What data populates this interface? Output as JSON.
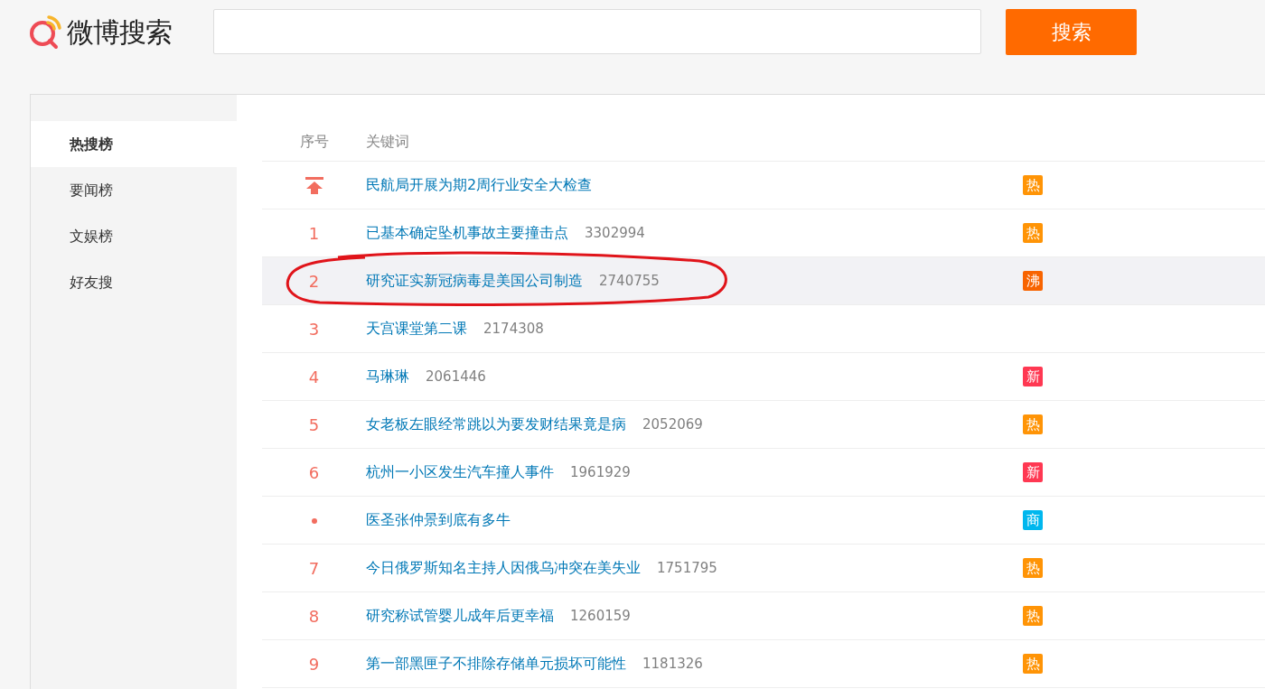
{
  "header": {
    "logo_text": "微博搜索",
    "search_button": "搜索"
  },
  "sidebar": {
    "items": [
      {
        "label": "热搜榜",
        "selected": true
      },
      {
        "label": "要闻榜",
        "selected": false
      },
      {
        "label": "文娱榜",
        "selected": false
      },
      {
        "label": "好友搜",
        "selected": false
      }
    ]
  },
  "table": {
    "columns": [
      "序号",
      "关键词"
    ],
    "rows": [
      {
        "kind": "pinned",
        "keyword": "民航局开展为期2周行业安全大检查",
        "badge": "热",
        "color": "#ff9406",
        "highlighted": false,
        "circled": false
      },
      {
        "kind": "number",
        "rank": "1",
        "keyword": "已基本确定坠机事故主要撞击点",
        "count": "3302994",
        "badge": "热",
        "color": "#ff9406",
        "highlighted": false,
        "circled": false
      },
      {
        "kind": "number",
        "rank": "2",
        "keyword": "研究证实新冠病毒是美国公司制造",
        "count": "2740755",
        "badge": "沸",
        "color": "#f86400",
        "highlighted": true,
        "circled": true
      },
      {
        "kind": "number",
        "rank": "3",
        "keyword": "天宫课堂第二课",
        "count": "2174308",
        "highlighted": false,
        "circled": false
      },
      {
        "kind": "number",
        "rank": "4",
        "keyword": "马琳琳",
        "count": "2061446",
        "badge": "新",
        "color": "#ff3852",
        "highlighted": false,
        "circled": false
      },
      {
        "kind": "number",
        "rank": "5",
        "keyword": "女老板左眼经常跳以为要发财结果竟是病",
        "count": "2052069",
        "badge": "热",
        "color": "#ff9406",
        "highlighted": false,
        "circled": false
      },
      {
        "kind": "number",
        "rank": "6",
        "keyword": "杭州一小区发生汽车撞人事件",
        "count": "1961929",
        "badge": "新",
        "color": "#ff3852",
        "highlighted": false,
        "circled": false
      },
      {
        "kind": "dot",
        "keyword": "医圣张仲景到底有多牛",
        "badge": "商",
        "color": "#00b7ee",
        "highlighted": false,
        "circled": false
      },
      {
        "kind": "number",
        "rank": "7",
        "keyword": "今日俄罗斯知名主持人因俄乌冲突在美失业",
        "count": "1751795",
        "badge": "热",
        "color": "#ff9406",
        "highlighted": false,
        "circled": false
      },
      {
        "kind": "number",
        "rank": "8",
        "keyword": "研究称试管婴儿成年后更幸福",
        "count": "1260159",
        "badge": "热",
        "color": "#ff9406",
        "highlighted": false,
        "circled": false
      },
      {
        "kind": "number",
        "rank": "9",
        "keyword": "第一部黑匣子不排除存储单元损坏可能性",
        "count": "1181326",
        "badge": "热",
        "color": "#ff9406",
        "highlighted": false,
        "circled": false
      }
    ]
  }
}
